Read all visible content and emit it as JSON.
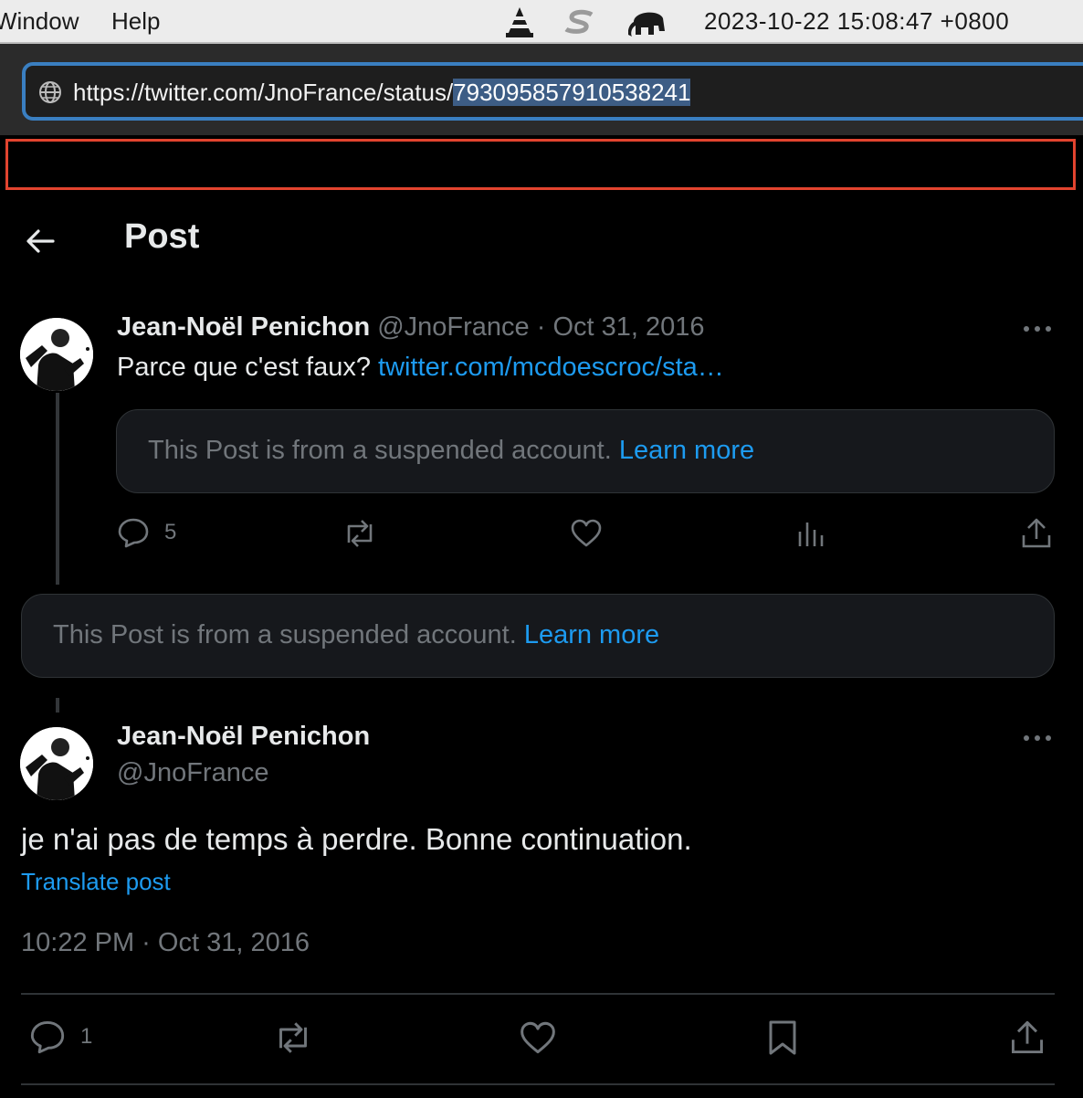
{
  "menubar": {
    "window_label": "Window",
    "help_label": "Help",
    "clock": "2023-10-22 15:08:47 +0800",
    "icons": [
      "vlc-cone-icon",
      "s-app-icon",
      "elephant-icon"
    ]
  },
  "browser": {
    "url_prefix": "https://twitter.com/JnoFrance/status/",
    "url_selected": "793095857910538241"
  },
  "header": {
    "title": "Post"
  },
  "parent_post": {
    "author_name": "Jean-Noël Penichon",
    "author_handle": "@JnoFrance",
    "separator": "·",
    "date": "Oct 31, 2016",
    "text": "Parce que c'est faux?",
    "link_text": "twitter.com/mcdoescroc/sta…",
    "quoted_notice": "This Post is from a suspended account.",
    "quoted_learn_more": "Learn more",
    "reply_count": "5"
  },
  "middle_notice": {
    "text": "This Post is from a suspended account.",
    "learn_more": "Learn more"
  },
  "main_post": {
    "author_name": "Jean-Noël Penichon",
    "author_handle": "@JnoFrance",
    "text": "je n'ai pas de temps à perdre. Bonne continuation.",
    "translate": "Translate post",
    "timestamp": "10:22 PM · Oct 31, 2016",
    "reply_count": "1"
  },
  "colors": {
    "accent": "#1d9bf0",
    "muted": "#71767b",
    "highlight_border": "#e2442f"
  }
}
